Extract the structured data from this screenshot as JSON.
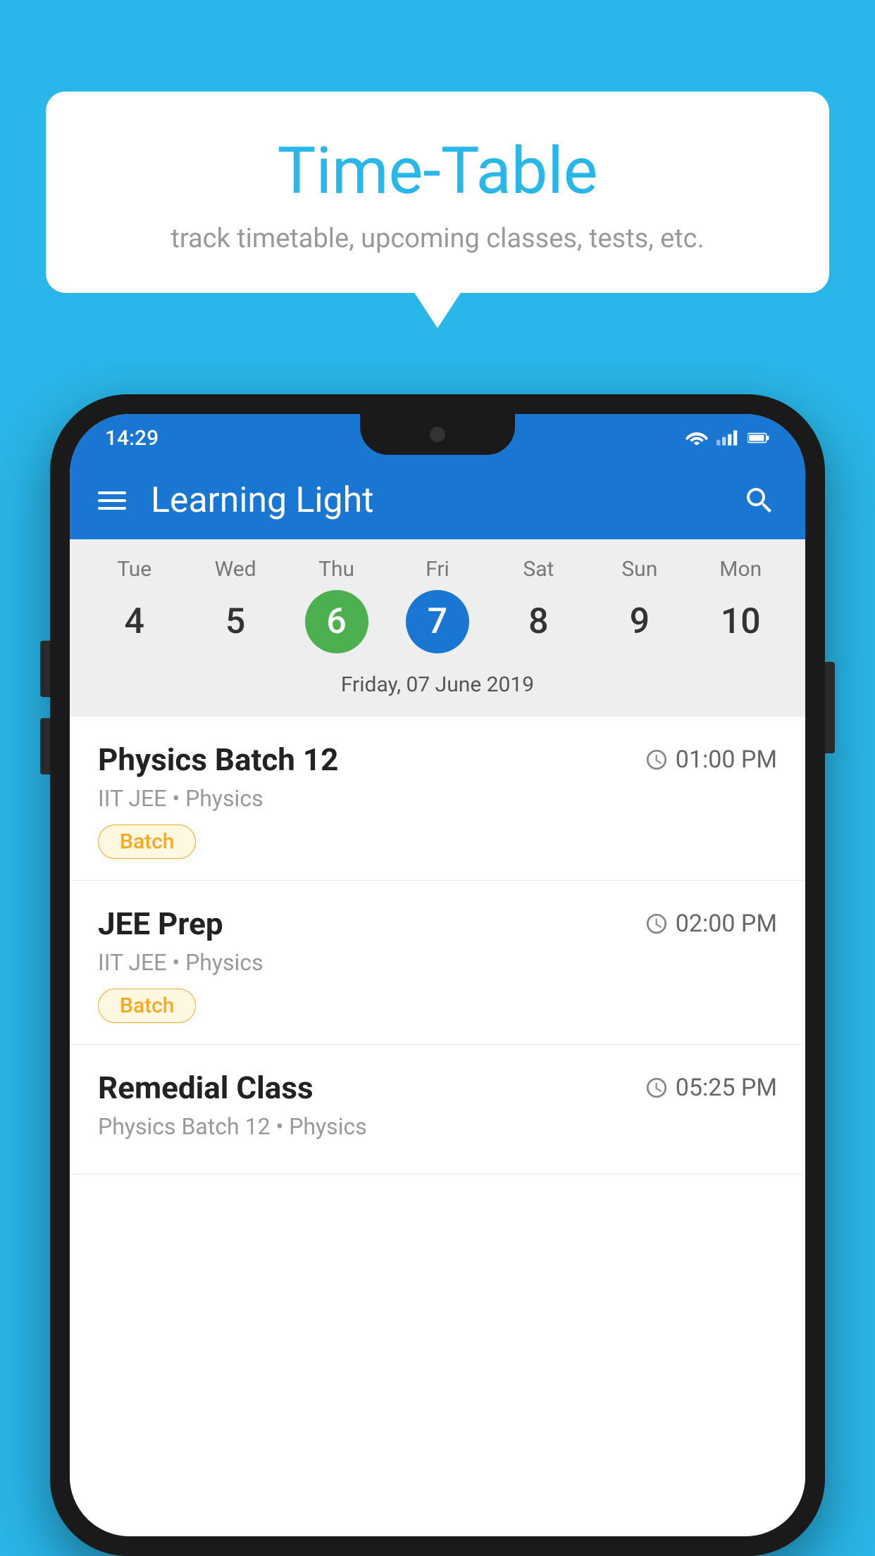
{
  "background_color": "#29B6E8",
  "bubble": {
    "title": "Time-Table",
    "subtitle": "track timetable, upcoming classes, tests, etc."
  },
  "phone": {
    "status_bar": {
      "time": "14:29"
    },
    "header": {
      "title": "Learning Light"
    },
    "calendar": {
      "days": [
        {
          "name": "Tue",
          "num": "4",
          "state": "normal"
        },
        {
          "name": "Wed",
          "num": "5",
          "state": "normal"
        },
        {
          "name": "Thu",
          "num": "6",
          "state": "today"
        },
        {
          "name": "Fri",
          "num": "7",
          "state": "selected"
        },
        {
          "name": "Sat",
          "num": "8",
          "state": "normal"
        },
        {
          "name": "Sun",
          "num": "9",
          "state": "normal"
        },
        {
          "name": "Mon",
          "num": "10",
          "state": "normal"
        }
      ],
      "selected_date_label": "Friday, 07 June 2019"
    },
    "events": [
      {
        "title": "Physics Batch 12",
        "time": "01:00 PM",
        "subtitle": "IIT JEE • Physics",
        "badge": "Batch"
      },
      {
        "title": "JEE Prep",
        "time": "02:00 PM",
        "subtitle": "IIT JEE • Physics",
        "badge": "Batch"
      },
      {
        "title": "Remedial Class",
        "time": "05:25 PM",
        "subtitle": "Physics Batch 12 • Physics",
        "badge": ""
      }
    ]
  },
  "icons": {
    "hamburger": "☰",
    "search": "🔍",
    "clock": "🕐"
  }
}
